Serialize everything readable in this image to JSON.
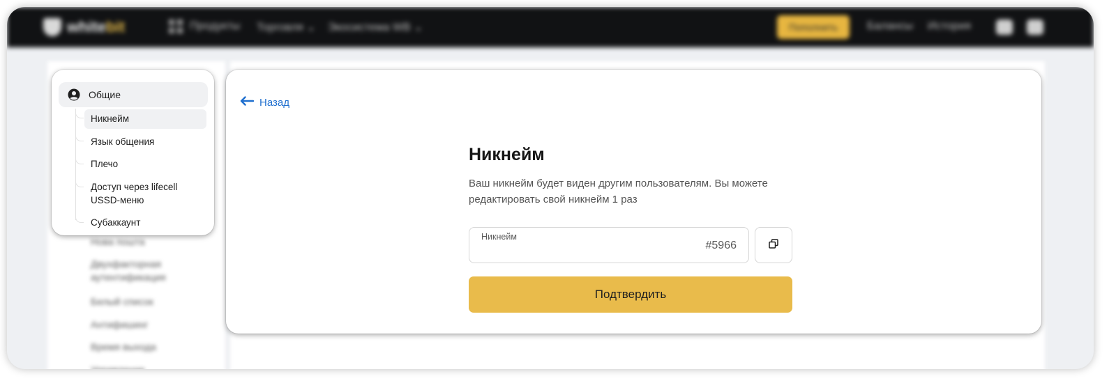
{
  "header": {
    "logo_main": "white",
    "logo_accent": "bit",
    "nav": [
      "Продукты",
      "Торговля ⌄",
      "Экосистема WB ⌄"
    ],
    "deposit_label": "Пополнить",
    "links": [
      "Балансы",
      "История"
    ],
    "icons": [
      "apps-grid-icon",
      "notifications-icon",
      "settings-icon"
    ]
  },
  "sidebar": {
    "section_label": "Общие",
    "section_icon": "user-circle-icon",
    "items": [
      {
        "label": "Никнейм",
        "active": true
      },
      {
        "label": "Язык общения",
        "active": false
      },
      {
        "label": "Плечо",
        "active": false
      },
      {
        "label": "Доступ через lifecell USSD-меню",
        "active": false
      },
      {
        "label": "Субаккаунт",
        "active": false
      }
    ],
    "blurred_items": [
      "Нова пошта",
      "Двухфакторная аутентификация",
      "Белый список",
      "Антифишинг",
      "Время выхода",
      "Управление"
    ]
  },
  "main": {
    "back_label": "Назад",
    "title": "Никнейм",
    "description": "Ваш никнейм будет виден другим пользователям. Вы можете редактировать свой никнейм 1 раз",
    "field": {
      "label": "Никнейм",
      "value": "",
      "suffix": "#5966"
    },
    "confirm_label": "Подтвердить"
  },
  "colors": {
    "accent": "#e9bb4b",
    "link": "#1f6fcf",
    "header_bg": "#111214"
  }
}
